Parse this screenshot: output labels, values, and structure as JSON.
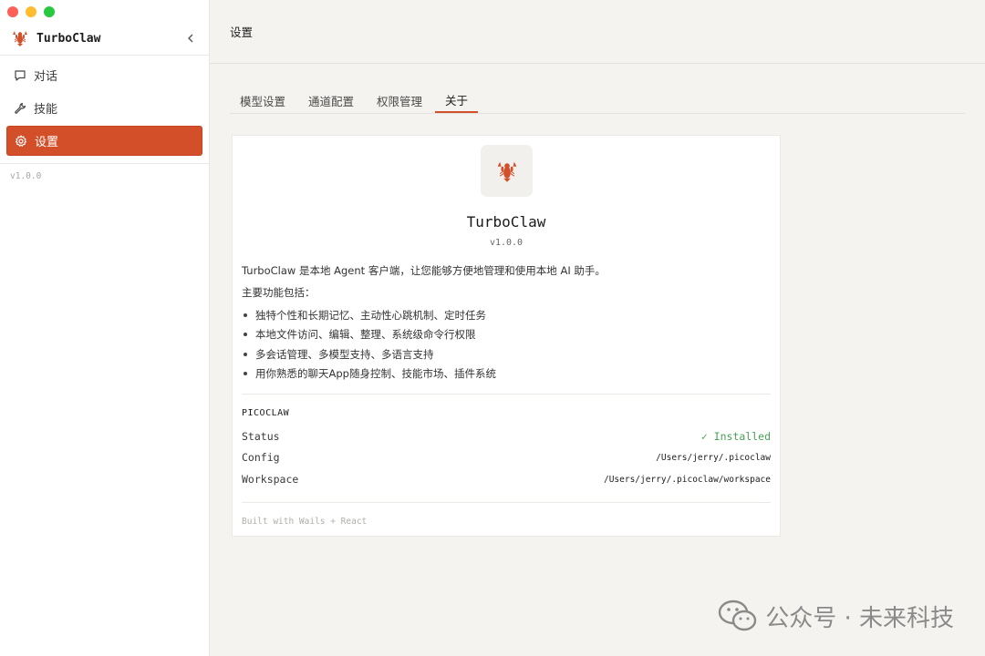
{
  "window": {
    "controls": [
      "close",
      "minimize",
      "maximize"
    ]
  },
  "sidebar": {
    "brand": {
      "name": "TurboClaw",
      "logo_icon": "lobster-icon"
    },
    "collapse_icon": "chevron-left-icon",
    "items": [
      {
        "label": "对话",
        "icon": "chat-bubble-icon",
        "active": false
      },
      {
        "label": "技能",
        "icon": "wrench-icon",
        "active": false
      },
      {
        "label": "设置",
        "icon": "gear-icon",
        "active": true
      }
    ],
    "version": "v1.0.0"
  },
  "header": {
    "title": "设置"
  },
  "tabs": [
    {
      "label": "模型设置",
      "active": false
    },
    {
      "label": "通道配置",
      "active": false
    },
    {
      "label": "权限管理",
      "active": false
    },
    {
      "label": "关于",
      "active": true
    }
  ],
  "about": {
    "app_icon": "lobster-icon",
    "app_name": "TurboClaw",
    "version": "v1.0.0",
    "description": "TurboClaw 是本地 Agent 客户端，让您能够方便地管理和使用本地 AI 助手。",
    "features_title": "主要功能包括：",
    "features": [
      "独特个性和长期记忆、主动性心跳机制、定时任务",
      "本地文件访问、编辑、整理、系统级命令行权限",
      "多会话管理、多模型支持、多语言支持",
      "用你熟悉的聊天App随身控制、技能市场、插件系统"
    ],
    "section_title": "PICOCLAW",
    "rows": [
      {
        "key": "Status",
        "value": "✓ Installed"
      },
      {
        "key": "Config",
        "value": "/Users/jerry/.picoclaw"
      },
      {
        "key": "Workspace",
        "value": "/Users/jerry/.picoclaw/workspace"
      }
    ],
    "footer": "Built with Wails + React"
  },
  "watermark": {
    "text": "公众号 · 未来科技",
    "icon": "wechat-icon"
  },
  "colors": {
    "accent": "#d24f2a",
    "success": "#4aa057",
    "sidebar_bg": "#ffffff",
    "main_bg": "#f4f3f0"
  }
}
